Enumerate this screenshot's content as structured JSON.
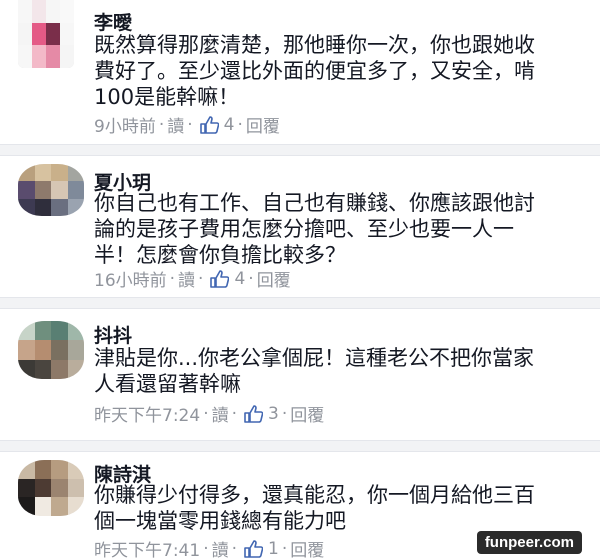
{
  "comments": [
    {
      "name": "李曖",
      "lines": [
        "既然算得那麼清楚，那他睡你一次，你也跟她收",
        "費好了。至少還比外面的便宜多了，又安全，啃",
        "100是能幹嘛！"
      ],
      "time": "9小時前",
      "read_label": "讀",
      "like_count": "4",
      "reply_label": "回覆"
    },
    {
      "name": "夏小玥",
      "lines": [
        "你自己也有工作、自己也有賺錢、你應該跟他討",
        "論的是孩子費用怎麼分擔吧、至少也要一人一",
        "半！怎麼會你負擔比較多？"
      ],
      "time": "16小時前",
      "read_label": "讀",
      "like_count": "4",
      "reply_label": "回覆"
    },
    {
      "name": "抖抖",
      "lines": [
        "津貼是你...你老公拿個屁！這種老公不把你當家",
        "人看還留著幹嘛"
      ],
      "time": "昨天下午7:24",
      "read_label": "讀",
      "like_count": "3",
      "reply_label": "回覆"
    },
    {
      "name": "陳詩淇",
      "lines": [
        "你賺得少付得多，還真能忍，你一個月給他三百",
        "個一塊當零用錢總有能力吧"
      ],
      "time": "昨天下午7:41",
      "read_label": "讀",
      "like_count": "1",
      "reply_label": "回覆"
    }
  ],
  "watermark": "funpeer.com",
  "colors": {
    "text": "#141823",
    "meta": "#90949c",
    "like_blue": "#4267b2",
    "separator": "#f2f3f5"
  },
  "icons": {
    "like": "thumbs-up-icon"
  }
}
